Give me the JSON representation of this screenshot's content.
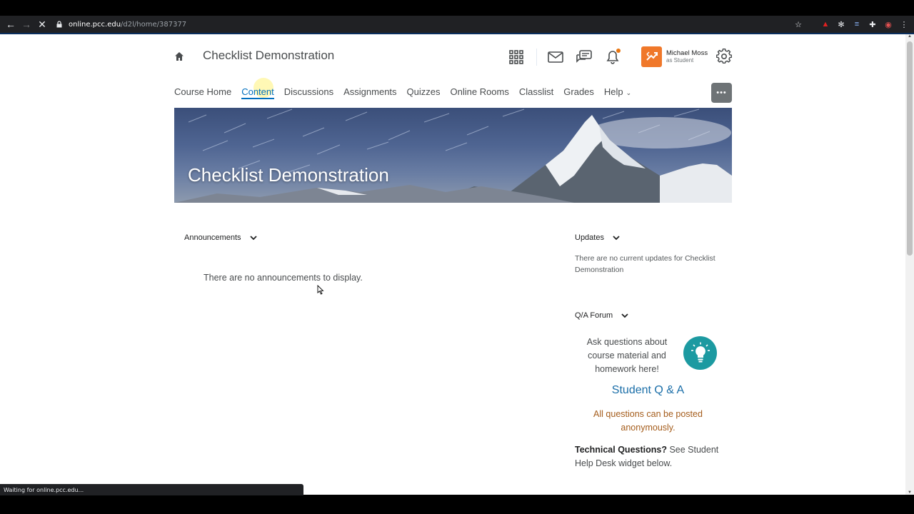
{
  "browser": {
    "url_host": "online.pcc.edu",
    "url_path": "/d2l/home/387377",
    "status_text": "Waiting for online.pcc.edu..."
  },
  "header": {
    "course_title": "Checklist Demonstration",
    "user_name": "Michael Moss",
    "user_role": "as Student",
    "accent_color": "#f0782a"
  },
  "nav": {
    "items": [
      {
        "label": "Course Home"
      },
      {
        "label": "Content"
      },
      {
        "label": "Discussions"
      },
      {
        "label": "Assignments"
      },
      {
        "label": "Quizzes"
      },
      {
        "label": "Online Rooms"
      },
      {
        "label": "Classlist"
      },
      {
        "label": "Grades"
      },
      {
        "label": "Help"
      }
    ],
    "active": "Content",
    "more_label": "•••"
  },
  "banner": {
    "title": "Checklist Demonstration"
  },
  "announcements": {
    "title": "Announcements",
    "empty_text": "There are no announcements to display."
  },
  "updates": {
    "title": "Updates",
    "text": "There are no current updates for Checklist Demonstration"
  },
  "qa_forum": {
    "title": "Q/A Forum",
    "prompt": "Ask questions about course material and homework here!",
    "link": "Student Q & A",
    "anonymous_note": "All questions can be posted anonymously.",
    "tech_bold": "Technical Questions?",
    "tech_rest": " See Student Help Desk widget below.",
    "link_color": "#1a6ea8",
    "note_color": "#a45c1b"
  }
}
